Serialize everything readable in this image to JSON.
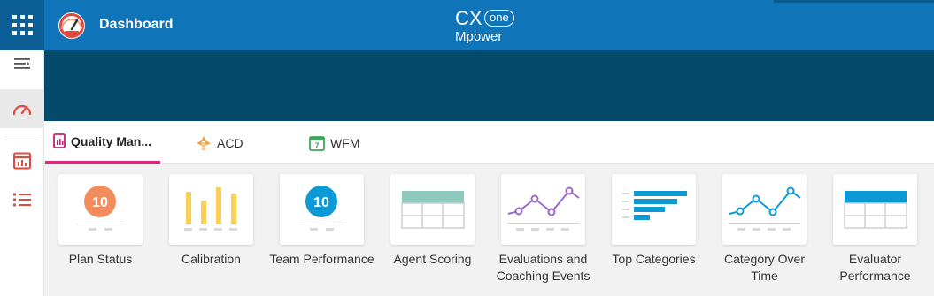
{
  "header": {
    "title": "Dashboard",
    "brand_top": "CX",
    "brand_one": "one",
    "brand_bottom": "Mpower"
  },
  "tabs": [
    {
      "label": "Quality Man...",
      "active": true,
      "icon": "quality-report-icon"
    },
    {
      "label": "ACD",
      "active": false,
      "icon": "acd-icon"
    },
    {
      "label": "WFM",
      "active": false,
      "icon": "calendar-icon"
    }
  ],
  "widgets": [
    {
      "label": "Plan Status",
      "icon": "orange-count-badge",
      "badge": "10"
    },
    {
      "label": "Calibration",
      "icon": "bar-chart-icon"
    },
    {
      "label": "Team Performance",
      "icon": "blue-count-badge",
      "badge": "10"
    },
    {
      "label": "Agent Scoring",
      "icon": "teal-table-icon"
    },
    {
      "label": "Evaluations and Coaching Events",
      "icon": "purple-line-chart-icon"
    },
    {
      "label": "Top Categories",
      "icon": "horizontal-bar-chart-icon"
    },
    {
      "label": "Category Over Time",
      "icon": "blue-line-chart-icon"
    },
    {
      "label": "Evaluator Performance",
      "icon": "blue-table-icon"
    }
  ],
  "colors": {
    "header": "#0f74b8",
    "banner": "#034a6b",
    "tab_accent": "#e0267f",
    "nav_icon": "#e4473c",
    "orange": "#f28c5c",
    "yellow": "#f8d154",
    "blue": "#0b9ad6",
    "teal": "#8ec9bd",
    "purple": "#9b69c9"
  }
}
